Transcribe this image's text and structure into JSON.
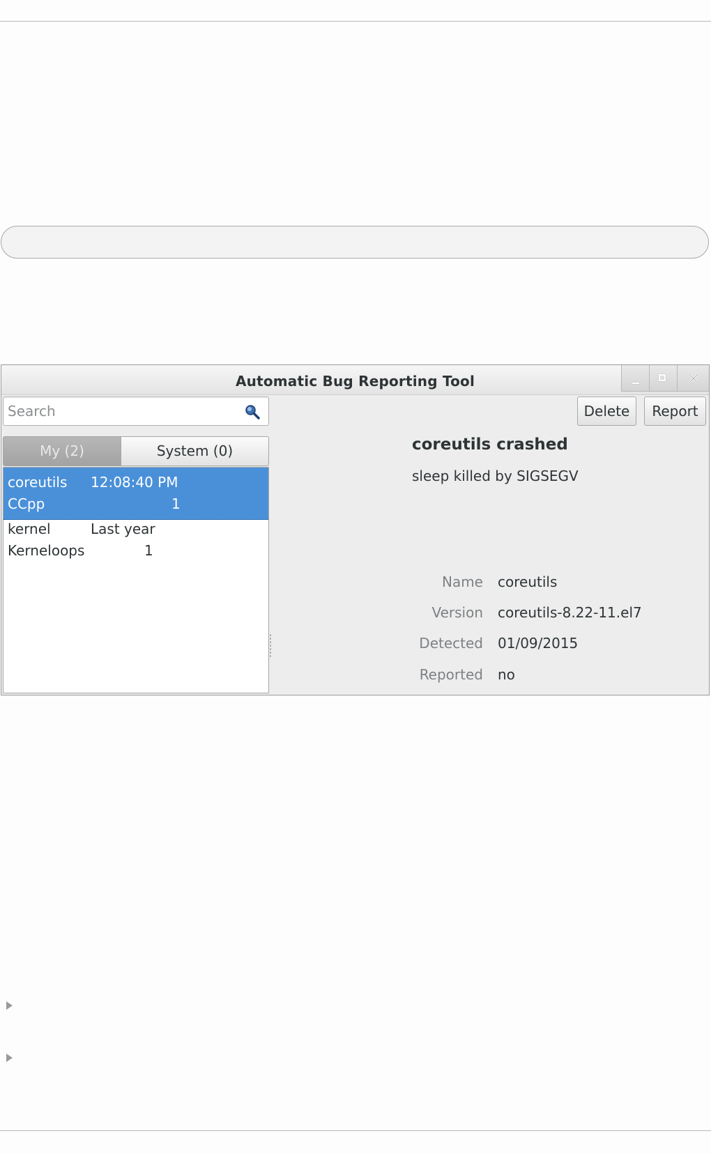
{
  "window": {
    "title": "Automatic Bug Reporting Tool"
  },
  "search": {
    "placeholder": "Search",
    "value": ""
  },
  "tabs": [
    {
      "label": "My (2)",
      "active": true
    },
    {
      "label": "System (0)",
      "active": false
    }
  ],
  "problems": [
    {
      "component": "coreutils",
      "time": "12:08:40 PM",
      "type": "CCpp",
      "count": "1",
      "selected": true
    },
    {
      "component": "kernel",
      "time": "Last year",
      "type": "Kerneloops",
      "count": "1",
      "selected": false
    }
  ],
  "toolbar": {
    "delete_label": "Delete",
    "report_label": "Report"
  },
  "details": {
    "title": "coreutils crashed",
    "subtitle": "sleep killed by SIGSEGV",
    "fields": [
      {
        "label": "Name",
        "value": "coreutils"
      },
      {
        "label": "Version",
        "value": "coreutils-8.22-11.el7"
      },
      {
        "label": "Detected",
        "value": "01/09/2015"
      },
      {
        "label": "Reported",
        "value": "no"
      }
    ]
  },
  "colors": {
    "selection": "#4a90d9",
    "window_bg": "#ededed",
    "text": "#2e3436",
    "muted_text": "#7d8183"
  },
  "icons": {
    "search": "search-icon",
    "minimize": "minimize-icon",
    "maximize": "maximize-icon",
    "close": "close-icon"
  }
}
